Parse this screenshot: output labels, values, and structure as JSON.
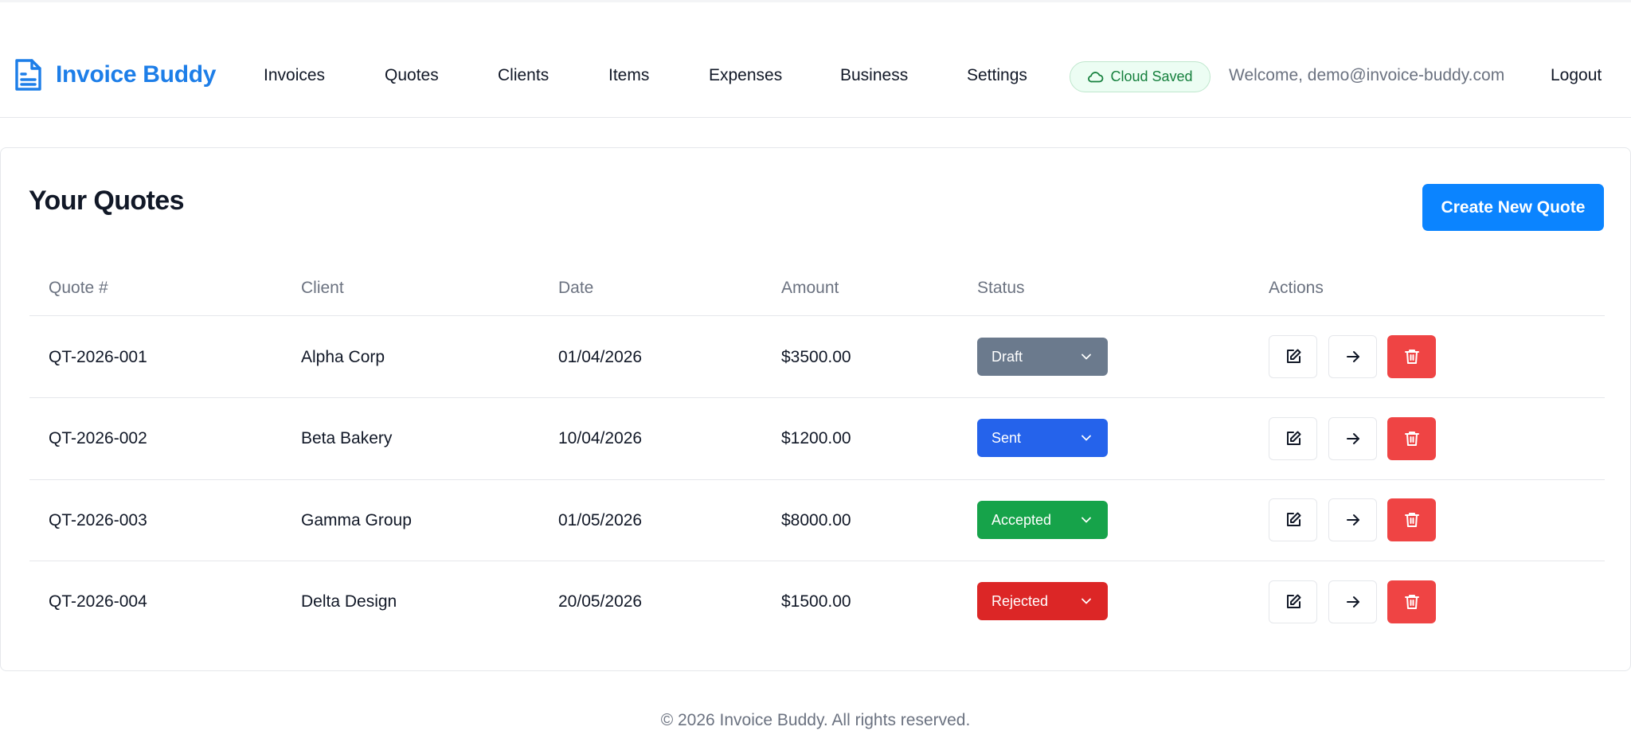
{
  "brand": {
    "name": "Invoice Buddy",
    "icon": "document-icon",
    "color": "#1d7ee8"
  },
  "nav": {
    "items": [
      {
        "label": "Invoices"
      },
      {
        "label": "Quotes"
      },
      {
        "label": "Clients"
      },
      {
        "label": "Items"
      },
      {
        "label": "Expenses"
      },
      {
        "label": "Business"
      },
      {
        "label": "Settings"
      }
    ],
    "cloud_status": {
      "label": "Cloud Saved",
      "icon": "cloud-icon",
      "color": "#15803d"
    },
    "welcome": "Welcome, demo@invoice-buddy.com",
    "logout": "Logout"
  },
  "page": {
    "title": "Your Quotes",
    "create_button": "Create New Quote",
    "accent": "#0b84ff"
  },
  "table": {
    "headers": [
      "Quote #",
      "Client",
      "Date",
      "Amount",
      "Status",
      "Actions"
    ],
    "rows": [
      {
        "quote": "QT-2026-001",
        "client": "Alpha Corp",
        "date": "01/04/2026",
        "amount": "$3500.00",
        "status": "Draft",
        "status_color": "#6b7a8d"
      },
      {
        "quote": "QT-2026-002",
        "client": "Beta Bakery",
        "date": "10/04/2026",
        "amount": "$1200.00",
        "status": "Sent",
        "status_color": "#2563eb"
      },
      {
        "quote": "QT-2026-003",
        "client": "Gamma Group",
        "date": "01/05/2026",
        "amount": "$8000.00",
        "status": "Accepted",
        "status_color": "#16a34a"
      },
      {
        "quote": "QT-2026-004",
        "client": "Delta Design",
        "date": "20/05/2026",
        "amount": "$1500.00",
        "status": "Rejected",
        "status_color": "#dc2626"
      }
    ],
    "actions": [
      {
        "icon": "edit-icon"
      },
      {
        "icon": "arrow-right-icon"
      },
      {
        "icon": "trash-icon",
        "color": "#ef4444"
      }
    ]
  },
  "footer": {
    "text": "© 2026 Invoice Buddy. All rights reserved."
  }
}
